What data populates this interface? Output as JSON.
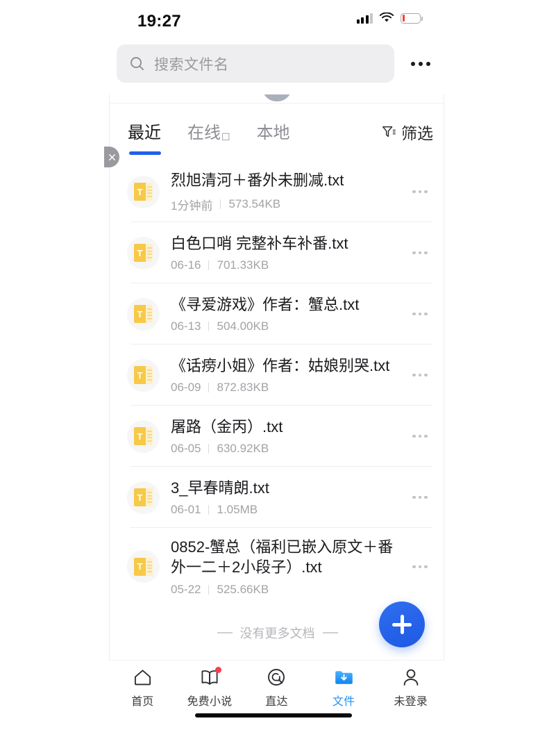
{
  "status_bar": {
    "time": "19:27",
    "signal_icon": "cellular-signal-icon",
    "wifi_icon": "wifi-icon",
    "battery_icon": "battery-low-icon"
  },
  "search": {
    "placeholder": "搜索文件名",
    "value": "",
    "icon": "search-icon",
    "more_icon": "more-horizontal-icon"
  },
  "tabs": {
    "items": [
      {
        "label": "最近",
        "active": true,
        "badge": ""
      },
      {
        "label": "在线",
        "active": false,
        "badge": "☐"
      },
      {
        "label": "本地",
        "active": false,
        "badge": ""
      }
    ],
    "filter": {
      "label": "筛选",
      "icon": "filter-icon"
    }
  },
  "edge_close": {
    "icon": "close-icon"
  },
  "files": {
    "items": [
      {
        "name": "烈旭清河＋番外未删减.txt",
        "date": "1分钟前",
        "size": "573.54KB",
        "icon": "txt-file-icon"
      },
      {
        "name": "白色口哨 完整补车补番.txt",
        "date": "06-16",
        "size": "701.33KB",
        "icon": "txt-file-icon"
      },
      {
        "name": "《寻爱游戏》作者：蟹总.txt",
        "date": "06-13",
        "size": "504.00KB",
        "icon": "txt-file-icon"
      },
      {
        "name": "《话痨小姐》作者：姑娘别哭.txt",
        "date": "06-09",
        "size": "872.83KB",
        "icon": "txt-file-icon"
      },
      {
        "name": "屠路（金丙）.txt",
        "date": "06-05",
        "size": "630.92KB",
        "icon": "txt-file-icon"
      },
      {
        "name": "3_早春晴朗.txt",
        "date": "06-01",
        "size": "1.05MB",
        "icon": "txt-file-icon"
      },
      {
        "name": "0852-蟹总（福利已嵌入原文＋番外一二＋2小段子）.txt",
        "date": "05-22",
        "size": "525.66KB",
        "icon": "txt-file-icon"
      }
    ],
    "end_text": "没有更多文档",
    "row_more_icon": "more-horizontal-icon",
    "file_badge_letter": "T"
  },
  "fab": {
    "label": "+",
    "icon": "plus-icon",
    "color": "#2160e8"
  },
  "bottom_nav": {
    "items": [
      {
        "label": "首页",
        "icon": "home-icon",
        "active": false,
        "badge": false
      },
      {
        "label": "免费小说",
        "icon": "book-icon",
        "active": false,
        "badge": true
      },
      {
        "label": "直达",
        "icon": "direct-search-icon",
        "active": false,
        "badge": false
      },
      {
        "label": "文件",
        "icon": "folder-download-icon",
        "active": true,
        "badge": false
      },
      {
        "label": "未登录",
        "icon": "person-icon",
        "active": false,
        "badge": false
      }
    ]
  },
  "colors": {
    "accent_blue": "#2160e8",
    "nav_active": "#2291f5",
    "file_icon_yellow": "#f7c948",
    "badge_red": "#fb3b4e"
  }
}
